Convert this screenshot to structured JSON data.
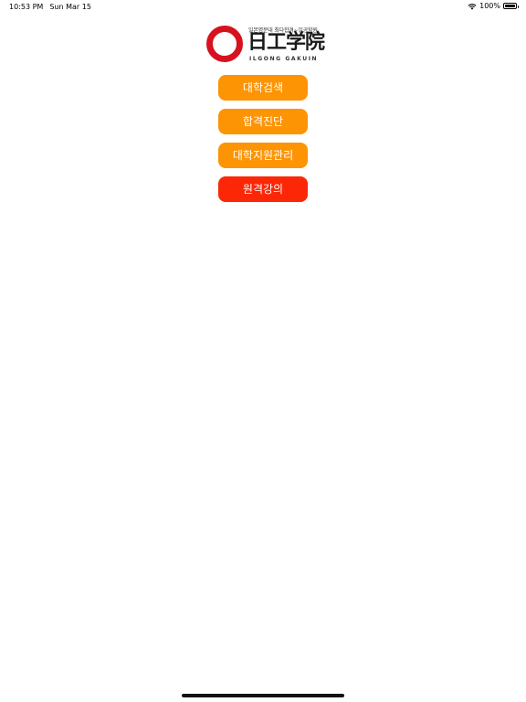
{
  "status_bar": {
    "time": "10:53 PM",
    "date": "Sun Mar 15",
    "wifi_icon": "wifi-icon",
    "battery_percent": "100%",
    "battery_icon": "battery-full-icon"
  },
  "logo": {
    "slogan": "일본명문대 최다합격~일공학원",
    "main_text": "日工学院",
    "sub_text": "ILGONG GAKUIN",
    "ring_color": "#d7121f"
  },
  "menu": {
    "items": [
      {
        "label": "대학검색",
        "color": "#fd9404"
      },
      {
        "label": "합격진단",
        "color": "#fd9404"
      },
      {
        "label": "대학지원관리",
        "color": "#fd9404"
      },
      {
        "label": "원격강의",
        "color": "#fc2707"
      }
    ]
  }
}
